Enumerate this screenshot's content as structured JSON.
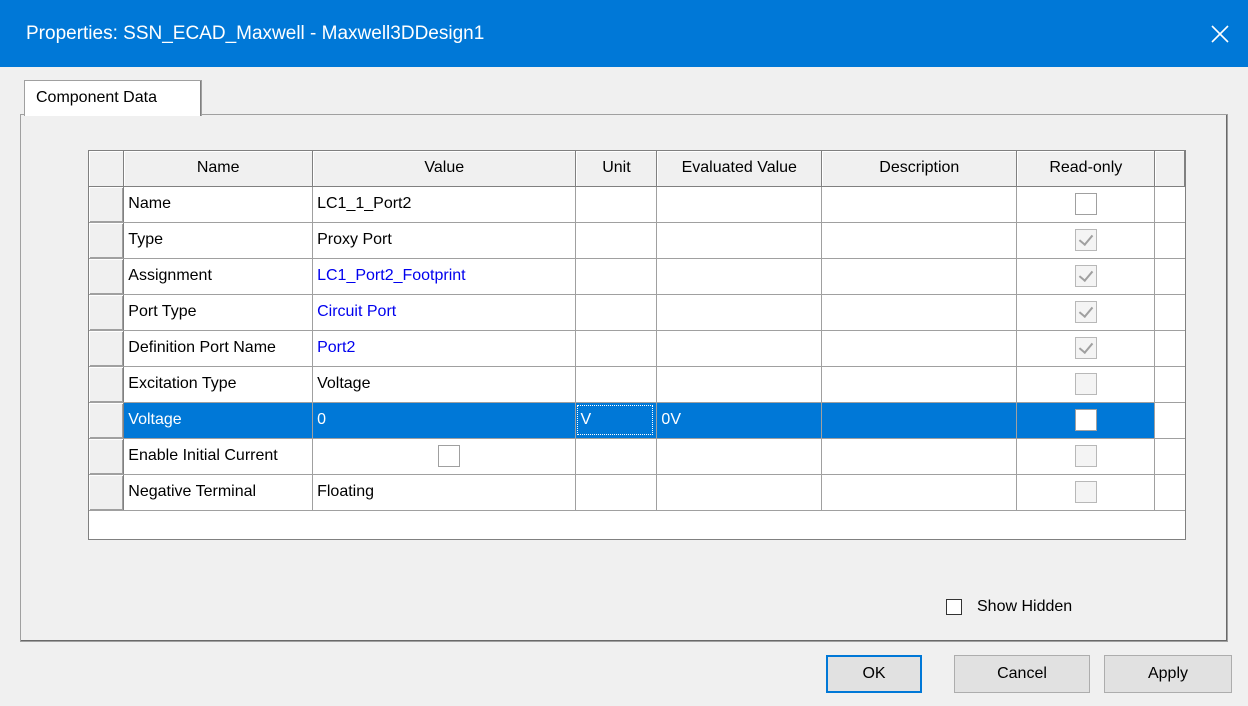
{
  "window": {
    "title": "Properties: SSN_ECAD_Maxwell - Maxwell3DDesign1"
  },
  "tabs": [
    {
      "label": "Component Data",
      "active": true
    }
  ],
  "grid": {
    "columns": [
      "Name",
      "Value",
      "Unit",
      "Evaluated Value",
      "Description",
      "Read-only"
    ],
    "rows": [
      {
        "name": "Name",
        "value": "LC1_1_Port2",
        "value_link": false,
        "unit": "",
        "evaluated": "",
        "description": "",
        "readonly": false,
        "readonly_checked": false
      },
      {
        "name": "Type",
        "value": "Proxy Port",
        "value_link": false,
        "unit": "",
        "evaluated": "",
        "description": "",
        "readonly": true,
        "readonly_checked": true
      },
      {
        "name": "Assignment",
        "value": "LC1_Port2_Footprint",
        "value_link": true,
        "unit": "",
        "evaluated": "",
        "description": "",
        "readonly": true,
        "readonly_checked": true
      },
      {
        "name": "Port Type",
        "value": "Circuit Port",
        "value_link": true,
        "unit": "",
        "evaluated": "",
        "description": "",
        "readonly": true,
        "readonly_checked": true
      },
      {
        "name": "Definition Port Name",
        "value": "Port2",
        "value_link": true,
        "unit": "",
        "evaluated": "",
        "description": "",
        "readonly": true,
        "readonly_checked": true
      },
      {
        "name": "Excitation Type",
        "value": "Voltage",
        "value_link": false,
        "unit": "",
        "evaluated": "",
        "description": "",
        "readonly": true,
        "readonly_checked": false
      },
      {
        "name": "Voltage",
        "value": "0",
        "value_link": false,
        "unit": "V",
        "evaluated": "0V",
        "description": "",
        "readonly": false,
        "readonly_checked": false,
        "selected": true
      },
      {
        "name": "Enable Initial Current",
        "value": "",
        "value_checkbox": true,
        "value_link": false,
        "unit": "",
        "evaluated": "",
        "description": "",
        "readonly": true,
        "readonly_checked": false
      },
      {
        "name": "Negative Terminal",
        "value": "Floating",
        "value_link": false,
        "unit": "",
        "evaluated": "",
        "description": "",
        "readonly": true,
        "readonly_checked": false
      }
    ]
  },
  "show_hidden": {
    "label": "Show Hidden",
    "checked": false
  },
  "buttons": {
    "ok": "OK",
    "cancel": "Cancel",
    "apply": "Apply"
  },
  "colors": {
    "titlebar": "#0078d7",
    "selection": "#0078d7",
    "link": "#0000ee"
  }
}
